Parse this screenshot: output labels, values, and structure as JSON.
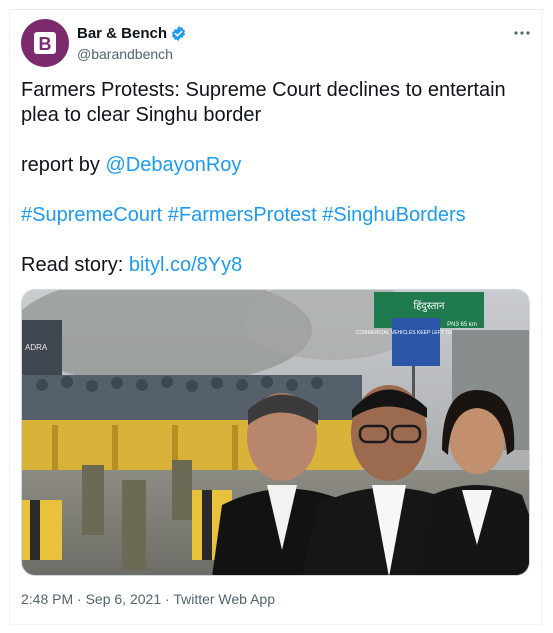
{
  "account": {
    "display_name": "Bar & Bench",
    "handle": "@barandbench",
    "avatar_letter": "B"
  },
  "tweet": {
    "line1": "Farmers Protests: Supreme Court declines to entertain plea to clear Singhu border",
    "report_prefix": "report by ",
    "report_mention": "@DebayonRoy",
    "hashtags": [
      "#SupremeCourt",
      "#FarmersProtest",
      "#SinghuBorders"
    ],
    "read_prefix": "Read story: ",
    "read_link": "bityl.co/8Yy8"
  },
  "image": {
    "sign_main": "हिंदुस्तान",
    "sign_sub": "बवाना",
    "sign_side": "COMMERCIAL VEHICLES\nKEEP LEFT\nTO PAY TOLL",
    "sign_km": "PN3 65 km",
    "truck_text": "ADRA"
  },
  "footer": {
    "time": "2:48 PM",
    "sep1": " · ",
    "date": "Sep 6, 2021",
    "sep2": " · ",
    "source": "Twitter Web App"
  },
  "colors": {
    "link": "#1d9bf0",
    "avatar_bg": "#7b2a6d",
    "muted": "#536471"
  }
}
